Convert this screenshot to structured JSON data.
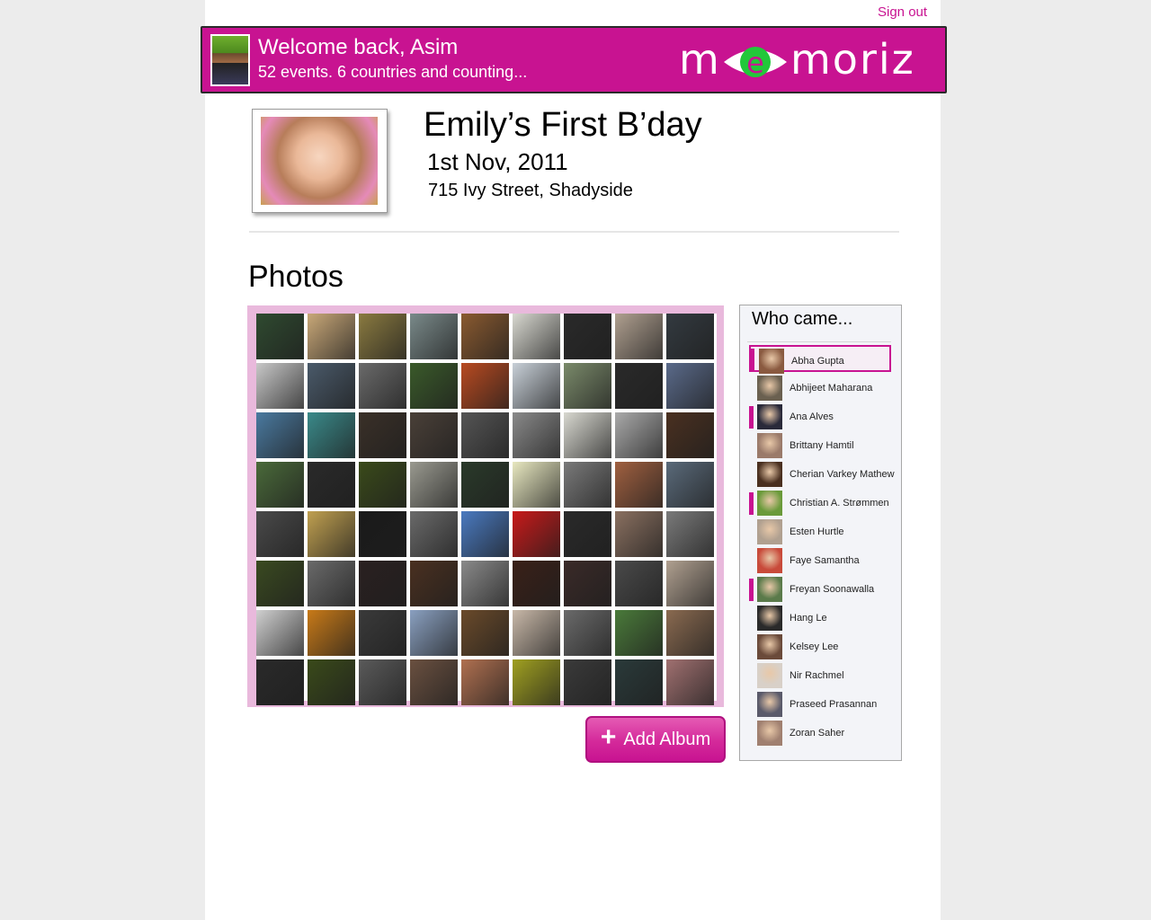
{
  "header": {
    "sign_out": "Sign out",
    "welcome": "Welcome back, Asim",
    "stats": "52 events. 6 countries and counting...",
    "brand": "memoriz",
    "brand_color": "#c81391"
  },
  "event": {
    "title": "Emily’s First B’day",
    "date": "1st Nov, 2011",
    "address": "715 Ivy Street, Shadyside"
  },
  "photos": {
    "heading": "Photos",
    "add_album": "Add Album",
    "thumbnails": [
      "#2f4a30",
      "#c9a878",
      "#8a7a40",
      "#7a8a8a",
      "#8a5a30",
      "#d8d8d0",
      "#2a2a2a",
      "#b0a090",
      "#333a40",
      "#c8c8c8",
      "#4a5a6a",
      "#6a6a6a",
      "#3a5a2a",
      "#b84a20",
      "#c8d0d8",
      "#7a8a6a",
      "#2a2a2a",
      "#5a6a8a",
      "#4a7aa0",
      "#3a8a8a",
      "#3a3028",
      "#4a4038",
      "#555555",
      "#8a8a8a",
      "#d8d8d0",
      "#aaaaaa",
      "#4a3020",
      "#4a6a3a",
      "#2a2a2a",
      "#3a4a1a",
      "#9a9a90",
      "#2a3a2a",
      "#e8e8c0",
      "#7a7a7a",
      "#a06040",
      "#5a6a7a",
      "#4a4a4a",
      "#c0a050",
      "#1a1a1a",
      "#6a6a6a",
      "#4a7ac0",
      "#c81a1a",
      "#2a2a2a",
      "#8a7060",
      "#7a7a7a",
      "#3a4a20",
      "#6a6a6a",
      "#2a2020",
      "#4a3020",
      "#8a8a8a",
      "#3a2018",
      "#3a2a28",
      "#4a4a4a",
      "#b0a090",
      "#d0d0d0",
      "#c87a18",
      "#3a3a3a",
      "#8aa0c0",
      "#6a4a2a",
      "#c8b8a8",
      "#6a6a6a",
      "#4a7a3a",
      "#8a6a50",
      "#2a2a2a",
      "#3a4a1a",
      "#5a5a5a",
      "#6a5040",
      "#b07050",
      "#a0a020",
      "#3a3a3a",
      "#2a3a3a",
      "#a07070"
    ]
  },
  "attendees": {
    "title": "Who came...",
    "people": [
      {
        "name": "Abha Gupta",
        "marked": true,
        "selected": true,
        "face": "#8a5a40"
      },
      {
        "name": "Abhijeet Maharana",
        "marked": false,
        "selected": false,
        "face": "#6a6050"
      },
      {
        "name": "Ana Alves",
        "marked": true,
        "selected": false,
        "face": "#2a2a3a"
      },
      {
        "name": "Brittany Hamtil",
        "marked": false,
        "selected": false,
        "face": "#9a7a6a"
      },
      {
        "name": "Cherian Varkey Mathew",
        "marked": false,
        "selected": false,
        "face": "#4a3020"
      },
      {
        "name": "Christian A. Strømmen",
        "marked": true,
        "selected": false,
        "face": "#6a9a3a"
      },
      {
        "name": "Esten Hurtle",
        "marked": false,
        "selected": false,
        "face": "#b0a090"
      },
      {
        "name": "Faye Samantha",
        "marked": false,
        "selected": false,
        "face": "#c84a3a"
      },
      {
        "name": "Freyan Soonawalla",
        "marked": true,
        "selected": false,
        "face": "#5a7a4a"
      },
      {
        "name": "Hang Le",
        "marked": false,
        "selected": false,
        "face": "#2a2a2a"
      },
      {
        "name": "Kelsey Lee",
        "marked": false,
        "selected": false,
        "face": "#6a4a3a"
      },
      {
        "name": "Nir Rachmel",
        "marked": false,
        "selected": false,
        "face": "#d8d0c8"
      },
      {
        "name": "Praseed Prasannan",
        "marked": false,
        "selected": false,
        "face": "#5a5a6a"
      },
      {
        "name": "Zoran Saher",
        "marked": false,
        "selected": false,
        "face": "#a08070"
      }
    ]
  }
}
